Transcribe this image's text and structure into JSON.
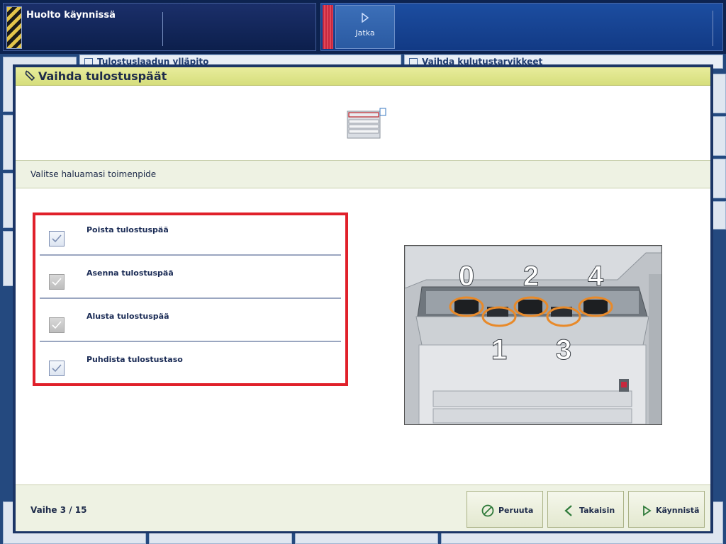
{
  "status_bar": {
    "title": "Huolto käynnissä"
  },
  "command_bar": {
    "continue_label": "Jatka",
    "continue_icon": "play-icon"
  },
  "background": {
    "tab_left": "Tulostuslaadun ylläpito",
    "tab_right": "Vaihda kulutustarvikkeet"
  },
  "dialog": {
    "title": "Vaihda tulostuspäät",
    "title_icon": "wrench-icon",
    "instruction": "Valitse haluamasi toimenpide",
    "options": [
      {
        "label": "Poista tulostuspää",
        "checked": true,
        "enabled": true
      },
      {
        "label": "Asenna tulostuspää",
        "checked": true,
        "enabled": false
      },
      {
        "label": "Alusta tulostuspää",
        "checked": true,
        "enabled": false
      },
      {
        "label": "Puhdista tulostustaso",
        "checked": true,
        "enabled": true
      }
    ],
    "printhead_numbers": [
      "0",
      "1",
      "2",
      "3",
      "4"
    ],
    "step_text": "Vaihe 3 / 15",
    "buttons": {
      "cancel": "Peruuta",
      "back": "Takaisin",
      "start": "Käynnistä"
    },
    "colors": {
      "highlight": "#e0202a",
      "callout": "#e88a2a",
      "accent": "#d6de7c"
    }
  }
}
